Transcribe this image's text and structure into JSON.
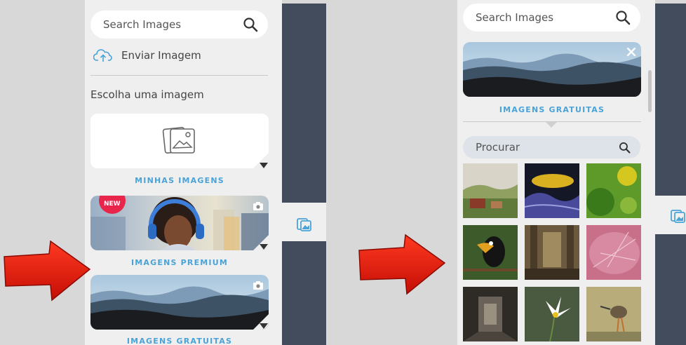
{
  "left_panel": {
    "search_placeholder": "Search Images",
    "upload_label": "Enviar Imagem",
    "choose_label": "Escolha uma imagem",
    "categories": [
      {
        "label": "MINHAS IMAGENS"
      },
      {
        "label": "IMAGENS PREMIUM",
        "badge": "NEW"
      },
      {
        "label": "IMAGENS GRATUITAS"
      }
    ]
  },
  "right_panel": {
    "search_placeholder": "Search Images",
    "selected_category": "IMAGENS GRATUITAS",
    "filter_placeholder": "Procurar"
  },
  "icons": [
    "search-icon",
    "cloud-upload-icon",
    "image-stack-icon",
    "camera-icon",
    "close-icon",
    "arrow-right-icon"
  ],
  "colors": {
    "accent": "#4aa3d8",
    "sidebar": "#424c5c",
    "panel": "#efefef",
    "badge": "#e8264c",
    "arrow": "#e31b10"
  }
}
